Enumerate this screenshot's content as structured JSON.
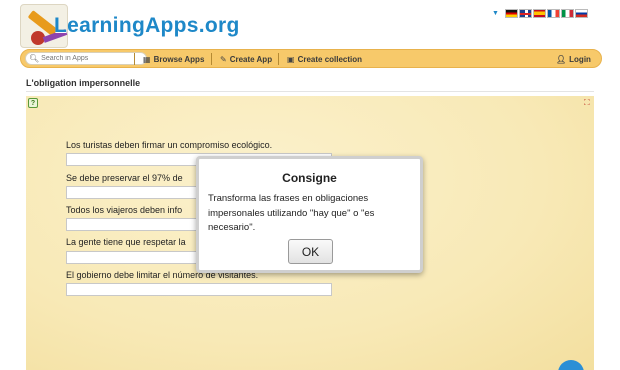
{
  "header": {
    "logo_text": "LearningApps.org",
    "languages": [
      {
        "code": "de",
        "icon": "flag-de"
      },
      {
        "code": "en",
        "icon": "flag-gb"
      },
      {
        "code": "es",
        "icon": "flag-es"
      },
      {
        "code": "fr",
        "icon": "flag-fr"
      },
      {
        "code": "it",
        "icon": "flag-it"
      },
      {
        "code": "ru",
        "icon": "flag-ru"
      }
    ]
  },
  "nav": {
    "search_placeholder": "Search in Apps",
    "browse_label": "Browse Apps",
    "create_label": "Create App",
    "collection_label": "Create collection",
    "login_label": "Login",
    "accent_color": "#f7c96a"
  },
  "page": {
    "title": "L'obligation impersonnelle"
  },
  "exercise": {
    "questions": [
      {
        "text": "Los turistas deben firmar un compromiso ecológico.",
        "answer": ""
      },
      {
        "text": "Se debe preservar el 97% de",
        "answer": ""
      },
      {
        "text": "Todos los viajeros deben info",
        "answer": ""
      },
      {
        "text": "La gente tiene que respetar la",
        "answer": ""
      },
      {
        "text": "El gobierno debe limitar el número de visitantes.",
        "answer": ""
      }
    ]
  },
  "dialog": {
    "title": "Consigne",
    "text": "Transforma las frases en obligaciones impersonales utilizando \"hay que\" o \"es necesario\".",
    "ok_label": "OK"
  }
}
